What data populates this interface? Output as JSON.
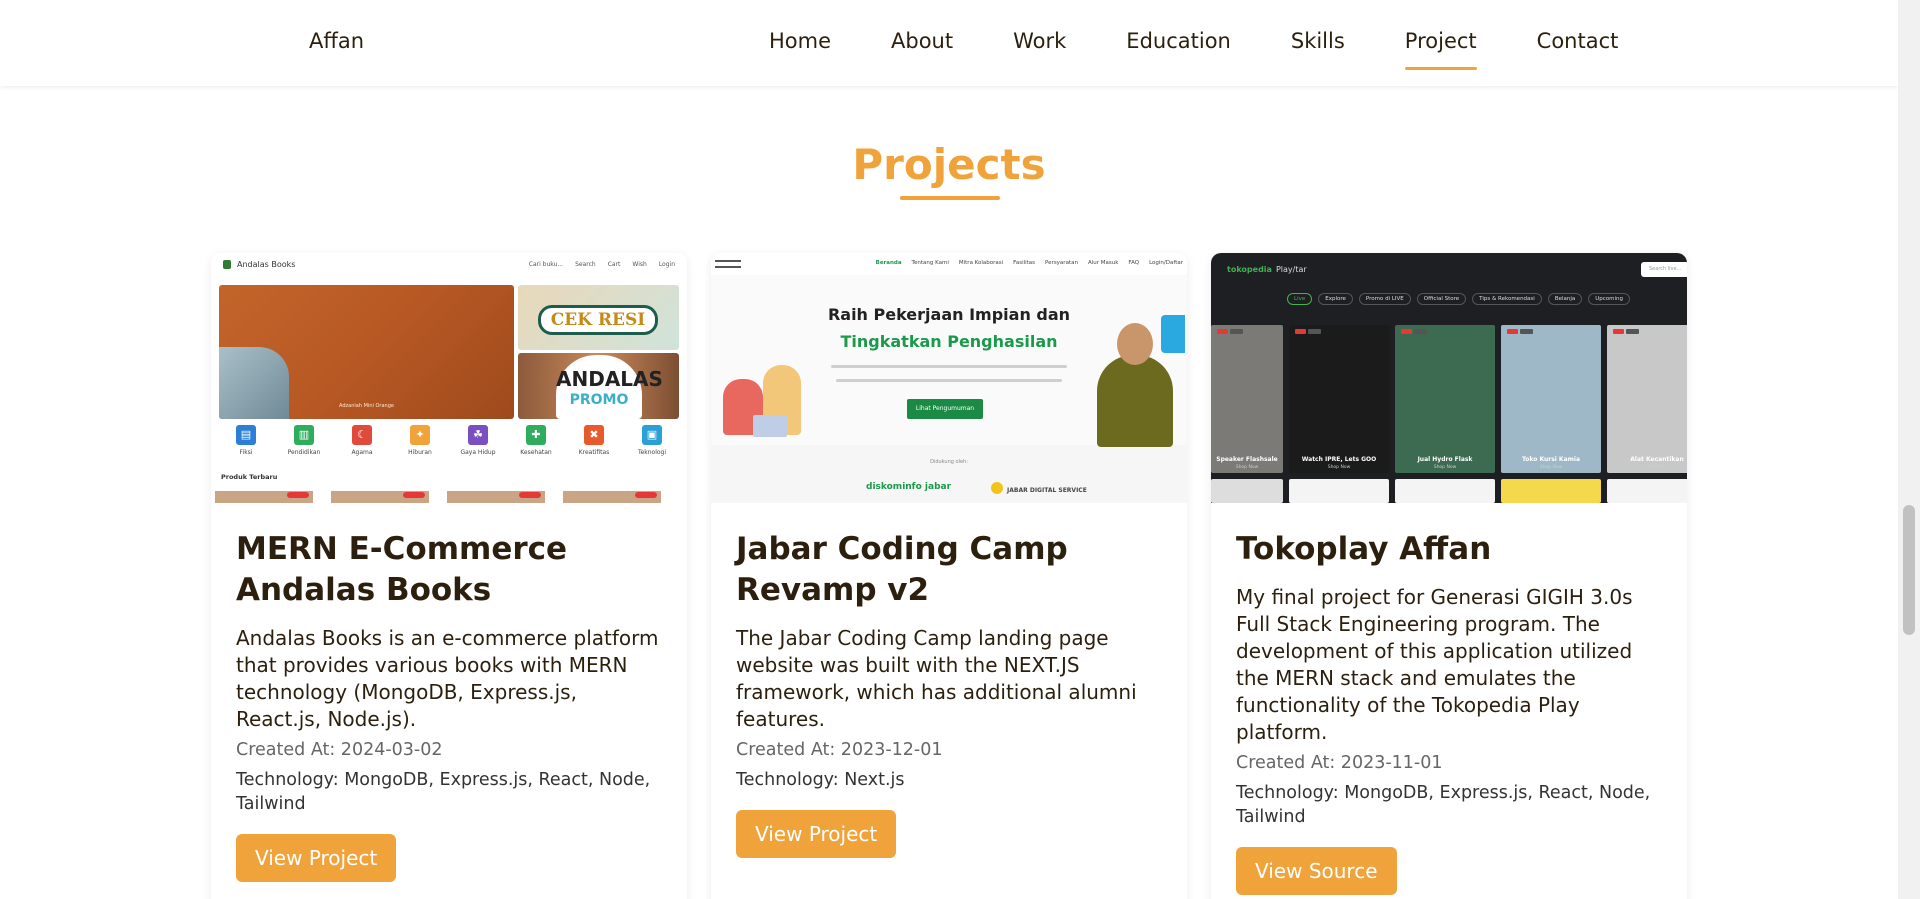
{
  "nav": {
    "brand": "Affan",
    "links": [
      "Home",
      "About",
      "Work",
      "Education",
      "Skills",
      "Project",
      "Contact"
    ],
    "active": "Project"
  },
  "section": {
    "title": "Projects"
  },
  "colors": {
    "accent": "#f0a33a",
    "text": "#2c1f0e"
  },
  "projects": [
    {
      "title": "MERN E-Commerce Andalas Books",
      "description": "Andalas Books is an e-commerce platform that provides various books with MERN technology (MongoDB, Express.js, React.js, Node.js).",
      "created": "Created At: 2024-03-02",
      "technology": "Technology: MongoDB, Express.js, React, Node, Tailwind",
      "button": "View Project",
      "thumb": {
        "brand": "Andalas Books",
        "top_items": [
          "Cari buku...",
          "Search",
          "Cart",
          "Wish",
          "Login"
        ],
        "hero_caption": "Adzaniah Mini Orange",
        "cek_resi": "CEK RESI",
        "promo_top": "ANDALAS",
        "promo_bottom": "PROMO",
        "categories": [
          {
            "label": "Fiksi",
            "color": "#2b7fd6"
          },
          {
            "label": "Pendidikan",
            "color": "#2eae5c"
          },
          {
            "label": "Agama",
            "color": "#e04a3a"
          },
          {
            "label": "Hiburan",
            "color": "#f0a33a"
          },
          {
            "label": "Gaya Hidup",
            "color": "#7a4fc2"
          },
          {
            "label": "Kesehatan",
            "color": "#2eae5c"
          },
          {
            "label": "Kreatifitas",
            "color": "#e85a2c"
          },
          {
            "label": "Teknologi",
            "color": "#2b9fd6"
          }
        ],
        "produk": "Produk Terbaru"
      }
    },
    {
      "title": "Jabar Coding Camp Revamp v2",
      "description": "The Jabar Coding Camp landing page website was built with the NEXT.JS framework, which has additional alumni features.",
      "created": "Created At: 2023-12-01",
      "technology": "Technology: Next.js",
      "button": "View Project",
      "thumb": {
        "menu": [
          "Beranda",
          "Tentang Kami",
          "Mitra Kolaborasi",
          "Fasilitas",
          "Persyaratan",
          "Alur Masuk",
          "FAQ",
          "Login/Daftar"
        ],
        "headline_1": "Raih Pekerjaan Impian dan",
        "headline_2": "Tingkatkan Penghasilan",
        "cta": "Lihat Pengumuman",
        "support": "Didukung oleh:",
        "logo_1": "diskominfo jabar",
        "logo_2": "JABAR DIGITAL SERVICE"
      }
    },
    {
      "title": "Tokoplay Affan",
      "description": "My final project for Generasi GIGIH 3.0s Full Stack Engineering program. The development of this application utilized the MERN stack and emulates the functionality of the Tokopedia Play platform.",
      "created": "Created At: 2023-11-01",
      "technology": "Technology: MongoDB, Express.js, React, Node, Tailwind",
      "button": "View Source",
      "thumb": {
        "brand": "tokopedia",
        "brand_sub": "Play/tar",
        "search": "Search live...",
        "pills": [
          "Live",
          "Explore",
          "Promo di LIVE",
          "Official Store",
          "Tips & Rekomendasi",
          "Belanja",
          "Upcoming"
        ],
        "tiles": [
          {
            "caption": "Speaker Flashsale",
            "sub": "Shop Now",
            "color": "#7c7a76"
          },
          {
            "caption": "Watch IPRE, Lets GOO",
            "sub": "Shop Now",
            "color": "#1b1b1b"
          },
          {
            "caption": "Jual Hydro Flask",
            "sub": "Shop Now",
            "color": "#3d6b52"
          },
          {
            "caption": "Toko Kursi Kamia",
            "sub": "Shop Now",
            "color": "#9fb8c8"
          },
          {
            "caption": "Alat Kecantikan",
            "sub": "Shop Now",
            "color": "#c8c8c8"
          }
        ]
      }
    }
  ]
}
